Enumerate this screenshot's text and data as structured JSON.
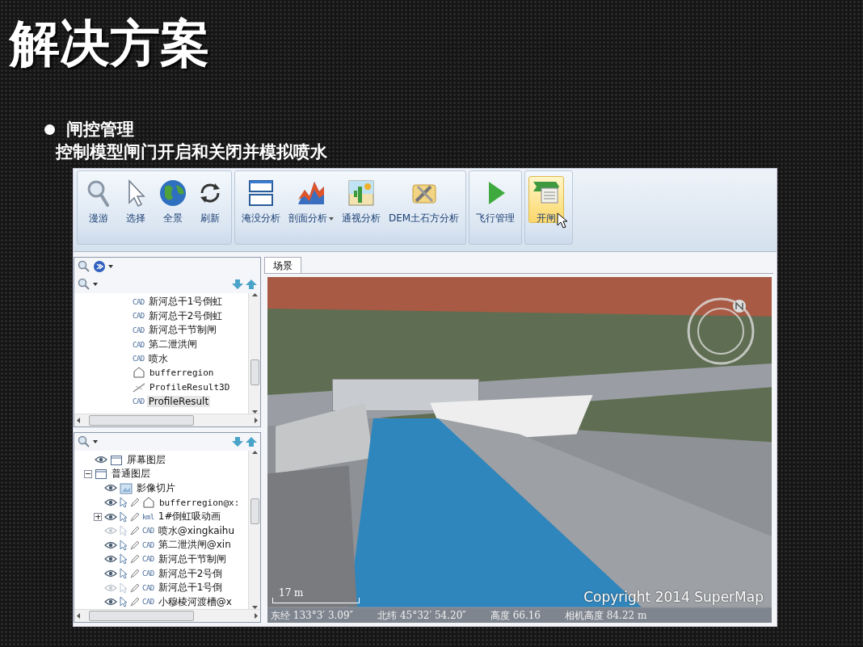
{
  "slide": {
    "title": "解决方案",
    "bullet": "闸控管理",
    "subtitle": "控制模型闸门开启和关闭并模拟喷水"
  },
  "ribbon": {
    "groups": [
      {
        "buttons": [
          {
            "label": "漫游"
          },
          {
            "label": "选择"
          },
          {
            "label": "全景"
          },
          {
            "label": "刷新"
          }
        ]
      },
      {
        "buttons": [
          {
            "label": "淹没分析"
          },
          {
            "label": "剖面分析",
            "dropdown": true
          },
          {
            "label": "通视分析"
          },
          {
            "label": "DEM土石方分析"
          }
        ]
      },
      {
        "buttons": [
          {
            "label": "飞行管理"
          }
        ]
      },
      {
        "buttons": [
          {
            "label": "开闸",
            "highlighted": true
          }
        ]
      }
    ]
  },
  "layer_tree": {
    "items": [
      {
        "badge": "CAD",
        "label": "新河总干1号倒虹",
        "selected": false
      },
      {
        "badge": "CAD",
        "label": "新河总干2号倒虹",
        "selected": false
      },
      {
        "badge": "CAD",
        "label": "新河总干节制闸",
        "selected": false
      },
      {
        "badge": "CAD",
        "label": "第二泄洪闸",
        "selected": false
      },
      {
        "badge": "CAD",
        "label": "喷水",
        "selected": false
      },
      {
        "kind": "region",
        "label": "bufferregion",
        "selected": false
      },
      {
        "kind": "profile",
        "label": "ProfileResult3D",
        "selected": false
      },
      {
        "badge": "CAD",
        "label": "ProfileResult",
        "selected": true
      }
    ]
  },
  "layer_manager": {
    "items": [
      {
        "label": "屏幕图层",
        "kind": "group",
        "visible": true
      },
      {
        "label": "普通图层",
        "kind": "group",
        "expanded": true,
        "children": [
          {
            "label": "影像切片",
            "kind": "image",
            "visible": true
          },
          {
            "label": "bufferregion@x:",
            "kind": "region",
            "visible": true
          },
          {
            "label": "1#倒虹吸动画",
            "badge": "kml",
            "visible": true,
            "expanded": false
          },
          {
            "label": "喷水@xingkaihu",
            "badge": "CAD",
            "visible": false
          },
          {
            "label": "第二泄洪闸@xin",
            "badge": "CAD",
            "visible": true
          },
          {
            "label": "新河总干节制闸",
            "badge": "CAD",
            "visible": true
          },
          {
            "label": "新河总干2号倒",
            "badge": "CAD",
            "visible": true
          },
          {
            "label": "新河总干1号倒",
            "badge": "CAD",
            "visible": false
          },
          {
            "label": "小穆棱河渡槽@x",
            "badge": "CAD",
            "visible": true
          }
        ]
      }
    ]
  },
  "scene": {
    "tabs": [
      {
        "label": "场景",
        "selected": true
      }
    ],
    "scale": "17 m",
    "copyright": "Copyright 2014 SuperMap",
    "status": [
      "东经 133°3′ 3.09″",
      "北纬 45°32′ 54.20″",
      "高度 66.16",
      "相机高度 84.22 m"
    ]
  }
}
